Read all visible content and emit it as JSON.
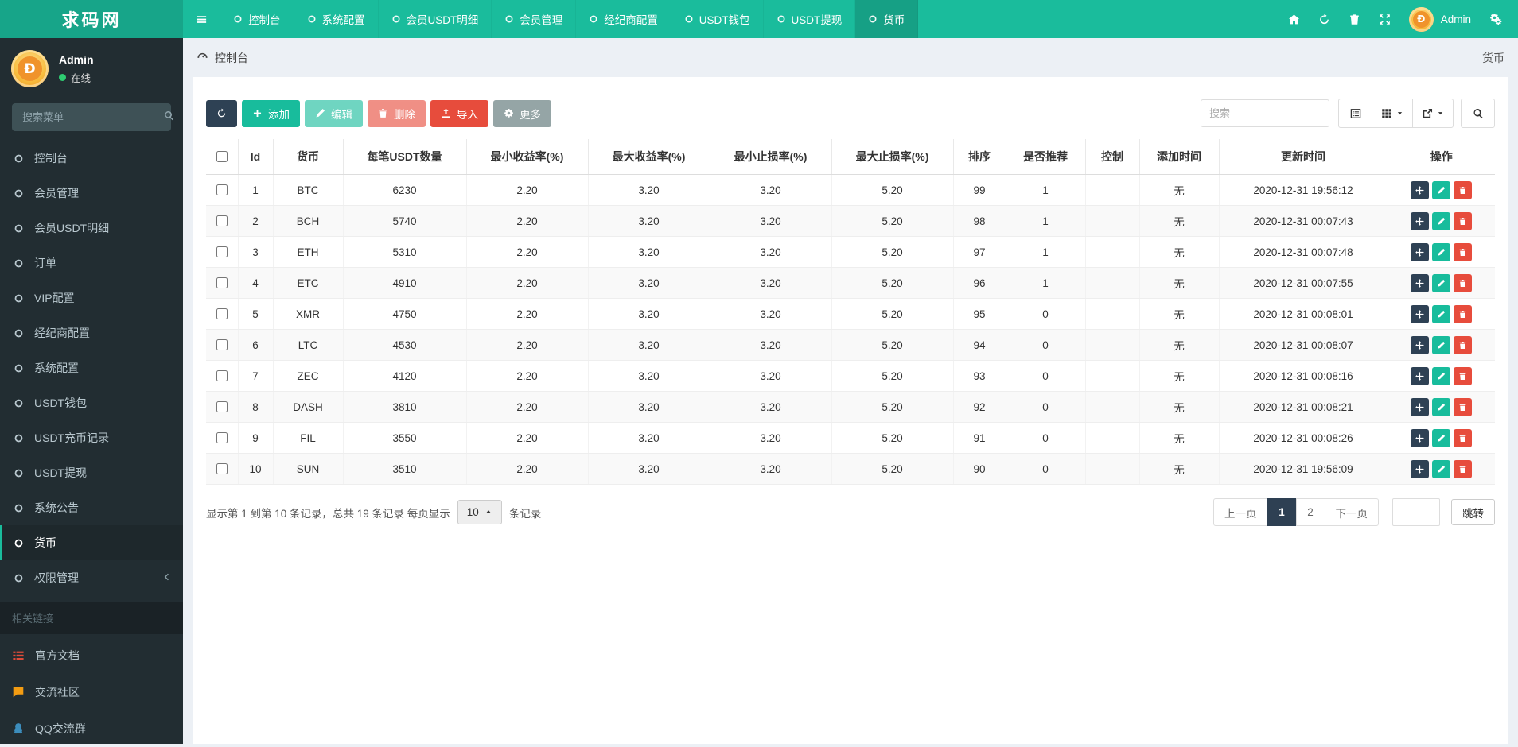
{
  "navbar": {
    "brand": "求码网",
    "menu": [
      {
        "name": "console",
        "label": "控制台"
      },
      {
        "name": "system-config",
        "label": "系统配置"
      },
      {
        "name": "member-usdt-detail",
        "label": "会员USDT明细"
      },
      {
        "name": "member-manage",
        "label": "会员管理"
      },
      {
        "name": "broker-config",
        "label": "经纪商配置"
      },
      {
        "name": "usdt-wallet",
        "label": "USDT钱包"
      },
      {
        "name": "usdt-withdraw",
        "label": "USDT提现"
      },
      {
        "name": "currency",
        "label": "货币",
        "active": true
      }
    ],
    "tools": [
      {
        "name": "home-button",
        "icon": "home-icon"
      },
      {
        "name": "refresh-button",
        "icon": "refresh-icon"
      },
      {
        "name": "clear-button",
        "icon": "trash-icon"
      },
      {
        "name": "fullscreen-button",
        "icon": "expand-icon"
      }
    ],
    "user_name": "Admin",
    "settings_icon": "cogs-icon"
  },
  "sidebar": {
    "user_name": "Admin",
    "user_status": "在线",
    "search_placeholder": "搜索菜单",
    "menu": [
      {
        "name": "console",
        "label": "控制台"
      },
      {
        "name": "member-manage",
        "label": "会员管理"
      },
      {
        "name": "member-usdt-detail",
        "label": "会员USDT明细"
      },
      {
        "name": "orders",
        "label": "订单"
      },
      {
        "name": "vip-config",
        "label": "VIP配置"
      },
      {
        "name": "broker-config",
        "label": "经纪商配置"
      },
      {
        "name": "system-config",
        "label": "系统配置"
      },
      {
        "name": "usdt-wallet",
        "label": "USDT钱包"
      },
      {
        "name": "usdt-deposit-record",
        "label": "USDT充币记录"
      },
      {
        "name": "usdt-withdraw",
        "label": "USDT提现"
      },
      {
        "name": "system-notice",
        "label": "系统公告"
      },
      {
        "name": "currency",
        "label": "货币",
        "active": true
      },
      {
        "name": "permission-manage",
        "label": "权限管理",
        "chevron": true
      }
    ],
    "section_label": "相关链接",
    "links": [
      {
        "name": "official-docs",
        "label": "官方文档",
        "icon": "doc-list-icon",
        "color": "#dd4b39"
      },
      {
        "name": "community",
        "label": "交流社区",
        "icon": "comment-icon",
        "color": "#f39c12"
      },
      {
        "name": "qq-group",
        "label": "QQ交流群",
        "icon": "qq-icon",
        "color": "#3c8dbc"
      }
    ]
  },
  "breadcrumb": {
    "location": "控制台",
    "page_title": "货币"
  },
  "toolbar": {
    "buttons": [
      {
        "name": "refresh-button",
        "icon": "refresh-icon",
        "label": "",
        "style": "dark"
      },
      {
        "name": "add-button",
        "icon": "plus-icon",
        "label": "添加",
        "style": "green"
      },
      {
        "name": "edit-button",
        "icon": "pencil-icon",
        "label": "编辑",
        "style": "green",
        "disabled": true
      },
      {
        "name": "delete-button",
        "icon": "trash-icon",
        "label": "删除",
        "style": "red",
        "disabled": true
      },
      {
        "name": "import-button",
        "icon": "upload-icon",
        "label": "导入",
        "style": "red"
      },
      {
        "name": "more-button",
        "icon": "gear-icon",
        "label": "更多",
        "style": "gray"
      }
    ],
    "search_placeholder": "搜索",
    "view_buttons": [
      {
        "name": "detail-view-button",
        "icon": "list-icon"
      },
      {
        "name": "columns-button",
        "icon": "grid-icon",
        "caret": true
      },
      {
        "name": "export-button",
        "icon": "export-icon",
        "caret": true
      }
    ],
    "search_button_icon": "search-icon"
  },
  "table": {
    "columns": [
      "Id",
      "货币",
      "每笔USDT数量",
      "最小收益率(%)",
      "最大收益率(%)",
      "最小止损率(%)",
      "最大止损率(%)",
      "排序",
      "是否推荐",
      "控制",
      "添加时间",
      "更新时间",
      "操作"
    ],
    "row_actions": [
      {
        "name": "move-row-button",
        "icon": "move-icon",
        "style": "dark"
      },
      {
        "name": "edit-row-button",
        "icon": "pencil-icon",
        "style": "green"
      },
      {
        "name": "delete-row-button",
        "icon": "trash-icon",
        "style": "red"
      }
    ],
    "rows": [
      {
        "id": "1",
        "currency": "BTC",
        "usdt": "6230",
        "min_profit": "2.20",
        "max_profit": "3.20",
        "min_stop": "3.20",
        "max_stop": "5.20",
        "sort": "99",
        "recommend": "1",
        "control": "",
        "add_time": "无",
        "update_time": "2020-12-31 19:56:12"
      },
      {
        "id": "2",
        "currency": "BCH",
        "usdt": "5740",
        "min_profit": "2.20",
        "max_profit": "3.20",
        "min_stop": "3.20",
        "max_stop": "5.20",
        "sort": "98",
        "recommend": "1",
        "control": "",
        "add_time": "无",
        "update_time": "2020-12-31 00:07:43"
      },
      {
        "id": "3",
        "currency": "ETH",
        "usdt": "5310",
        "min_profit": "2.20",
        "max_profit": "3.20",
        "min_stop": "3.20",
        "max_stop": "5.20",
        "sort": "97",
        "recommend": "1",
        "control": "",
        "add_time": "无",
        "update_time": "2020-12-31 00:07:48"
      },
      {
        "id": "4",
        "currency": "ETC",
        "usdt": "4910",
        "min_profit": "2.20",
        "max_profit": "3.20",
        "min_stop": "3.20",
        "max_stop": "5.20",
        "sort": "96",
        "recommend": "1",
        "control": "",
        "add_time": "无",
        "update_time": "2020-12-31 00:07:55"
      },
      {
        "id": "5",
        "currency": "XMR",
        "usdt": "4750",
        "min_profit": "2.20",
        "max_profit": "3.20",
        "min_stop": "3.20",
        "max_stop": "5.20",
        "sort": "95",
        "recommend": "0",
        "control": "",
        "add_time": "无",
        "update_time": "2020-12-31 00:08:01"
      },
      {
        "id": "6",
        "currency": "LTC",
        "usdt": "4530",
        "min_profit": "2.20",
        "max_profit": "3.20",
        "min_stop": "3.20",
        "max_stop": "5.20",
        "sort": "94",
        "recommend": "0",
        "control": "",
        "add_time": "无",
        "update_time": "2020-12-31 00:08:07"
      },
      {
        "id": "7",
        "currency": "ZEC",
        "usdt": "4120",
        "min_profit": "2.20",
        "max_profit": "3.20",
        "min_stop": "3.20",
        "max_stop": "5.20",
        "sort": "93",
        "recommend": "0",
        "control": "",
        "add_time": "无",
        "update_time": "2020-12-31 00:08:16"
      },
      {
        "id": "8",
        "currency": "DASH",
        "usdt": "3810",
        "min_profit": "2.20",
        "max_profit": "3.20",
        "min_stop": "3.20",
        "max_stop": "5.20",
        "sort": "92",
        "recommend": "0",
        "control": "",
        "add_time": "无",
        "update_time": "2020-12-31 00:08:21"
      },
      {
        "id": "9",
        "currency": "FIL",
        "usdt": "3550",
        "min_profit": "2.20",
        "max_profit": "3.20",
        "min_stop": "3.20",
        "max_stop": "5.20",
        "sort": "91",
        "recommend": "0",
        "control": "",
        "add_time": "无",
        "update_time": "2020-12-31 00:08:26"
      },
      {
        "id": "10",
        "currency": "SUN",
        "usdt": "3510",
        "min_profit": "2.20",
        "max_profit": "3.20",
        "min_stop": "3.20",
        "max_stop": "5.20",
        "sort": "90",
        "recommend": "0",
        "control": "",
        "add_time": "无",
        "update_time": "2020-12-31 19:56:09"
      }
    ]
  },
  "pagination": {
    "info_prefix": "显示第 1 到第 10 条记录，总共 19 条记录 每页显示",
    "page_size": "10",
    "info_suffix": "条记录",
    "prev_label": "上一页",
    "pages": [
      {
        "label": "1",
        "active": true
      },
      {
        "label": "2"
      }
    ],
    "next_label": "下一页",
    "jump_label": "跳转"
  },
  "colors": {
    "accent": "#1abc9c",
    "accent_dark": "#16a085",
    "navy": "#2e4154",
    "green": "#18bc9c",
    "red": "#e74c3c",
    "gray": "#95a5a6"
  }
}
